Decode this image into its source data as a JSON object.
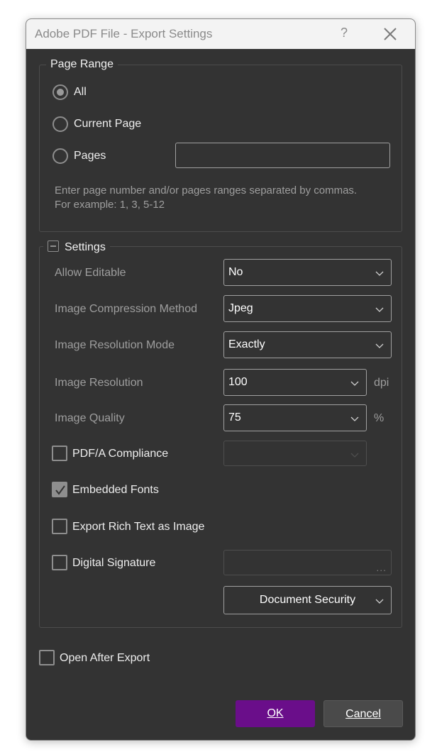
{
  "window": {
    "title": "Adobe PDF File - Export Settings",
    "help_glyph": "?"
  },
  "page_range": {
    "group_label": "Page Range",
    "options": [
      {
        "label": "All",
        "checked": true
      },
      {
        "label": "Current Page",
        "checked": false
      },
      {
        "label": "Pages",
        "checked": false
      }
    ],
    "pages_value": "",
    "hint_line1": "Enter page number and/or pages ranges separated by commas.",
    "hint_line2": "For example: 1, 3, 5-12"
  },
  "settings": {
    "group_label": "Settings",
    "allow_editable": {
      "label": "Allow Editable",
      "value": "No"
    },
    "image_compression": {
      "label": "Image Compression Method",
      "value": "Jpeg"
    },
    "image_resolution_mode": {
      "label": "Image Resolution Mode",
      "value": "Exactly"
    },
    "image_resolution": {
      "label": "Image Resolution",
      "value": "100",
      "unit": "dpi"
    },
    "image_quality": {
      "label": "Image Quality",
      "value": "75",
      "unit": "%"
    },
    "pdfa_compliance": {
      "label": "PDF/A Compliance",
      "checked": false,
      "value": ""
    },
    "embedded_fonts": {
      "label": "Embedded Fonts",
      "checked": true
    },
    "export_rich_text": {
      "label": "Export Rich Text as Image",
      "checked": false
    },
    "digital_signature": {
      "label": "Digital Signature",
      "checked": false,
      "value": "",
      "browse_label": "..."
    },
    "document_security": {
      "label": "Document Security"
    }
  },
  "open_after_export": {
    "label": "Open After Export",
    "checked": false
  },
  "buttons": {
    "ok": "OK",
    "cancel": "Cancel"
  },
  "colors": {
    "dialog_bg": "#333333",
    "titlebar_bg": "#f3f3f3",
    "accent": "#6a0e8a"
  }
}
